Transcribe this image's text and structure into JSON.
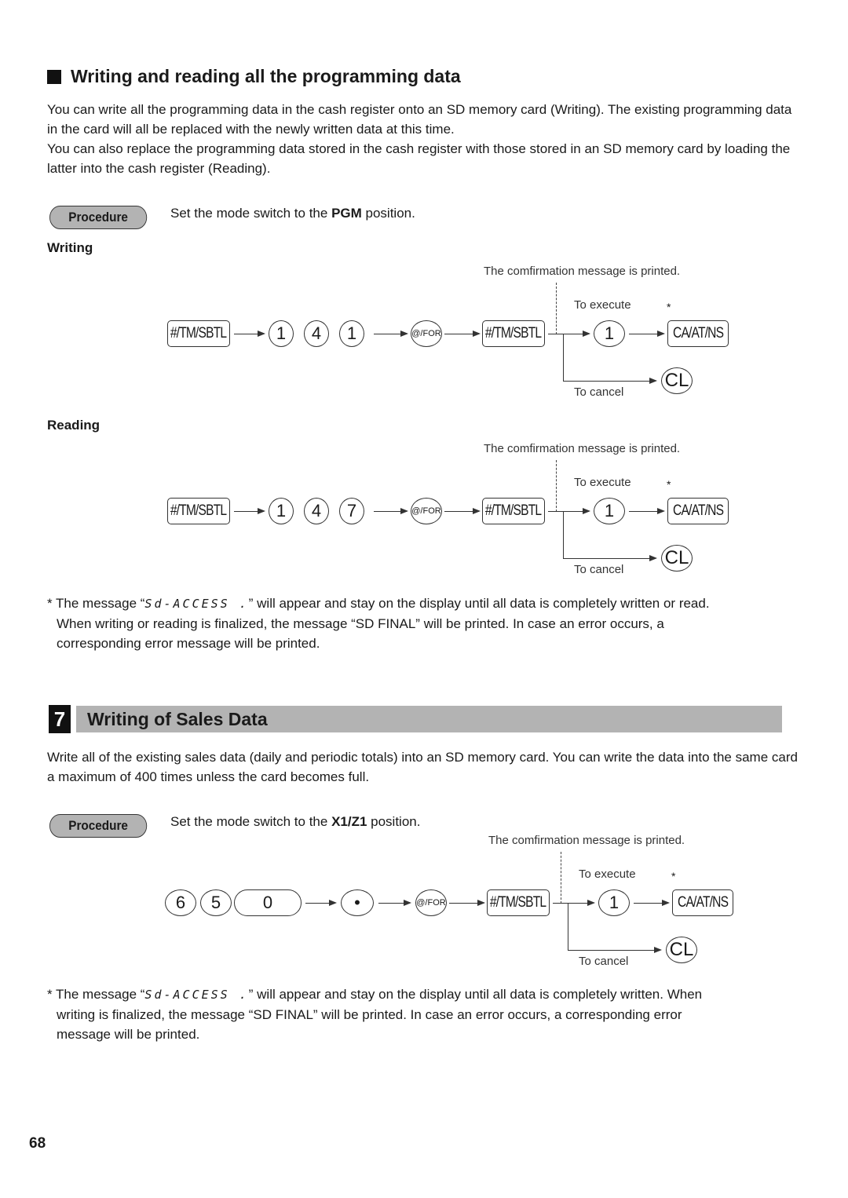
{
  "section1": {
    "title": "Writing and reading all the programming data",
    "paragraphs": [
      "You can write all the programming data in the cash register onto an SD memory card (Writing). The existing programming data in the card will all be replaced with the newly written data at this time.",
      "You can also replace the programming data stored in the cash register with those stored in an SD memory card by loading the latter into the cash register (Reading)."
    ],
    "procedure_label": "Procedure",
    "procedure_text_pre": "Set the mode switch to the ",
    "procedure_text_bold": "PGM",
    "procedure_text_post": " position.",
    "writing": {
      "heading": "Writing",
      "keys": [
        "#/TM/SBTL",
        "1",
        "4",
        "1",
        "@/FOR",
        "#/TM/SBTL",
        "1",
        "CA/AT/NS",
        "CL"
      ],
      "confirmation_note": "The comfirmation message is printed.",
      "execute_label": "To execute",
      "cancel_label": "To cancel",
      "star": "*"
    },
    "reading": {
      "heading": "Reading",
      "keys": [
        "#/TM/SBTL",
        "1",
        "4",
        "7",
        "@/FOR",
        "#/TM/SBTL",
        "1",
        "CA/AT/NS",
        "CL"
      ],
      "confirmation_note": "The comfirmation message is printed.",
      "execute_label": "To execute",
      "cancel_label": "To cancel",
      "star": "*"
    },
    "footnote": {
      "star": "*",
      "pre": " The message “",
      "lcd": "Sd-ACCESS .",
      "post": "” will appear and stay on the display until all data is completely written or read.",
      "line2": "When writing or reading is finalized, the message “SD FINAL” will be printed. In case an error occurs, a",
      "line3": "corresponding error message will be printed."
    }
  },
  "section2": {
    "number": "7",
    "title": "Writing of Sales Data",
    "paragraph": "Write all of the existing sales data (daily and periodic totals) into an SD memory card. You can write the data into the same card a maximum of 400 times unless the card becomes full.",
    "procedure_label": "Procedure",
    "procedure_text_pre": "Set the mode switch to the ",
    "procedure_text_bold": "X1/Z1",
    "procedure_text_post": " position.",
    "diagram": {
      "keys": [
        "6",
        "5",
        "0",
        "•",
        "@/FOR",
        "#/TM/SBTL",
        "1",
        "CA/AT/NS",
        "CL"
      ],
      "confirmation_note": "The comfirmation message is printed.",
      "execute_label": "To execute",
      "cancel_label": "To cancel",
      "star": "*"
    },
    "footnote": {
      "star": "*",
      "pre": " The message “",
      "lcd": "Sd-ACCESS .",
      "post": "” will appear and stay on the display until all data is completely written. When",
      "line2": "writing is finalized, the message “SD FINAL” will be printed. In case an error occurs, a corresponding error",
      "line3": "message will be printed."
    }
  },
  "page_number": "68"
}
